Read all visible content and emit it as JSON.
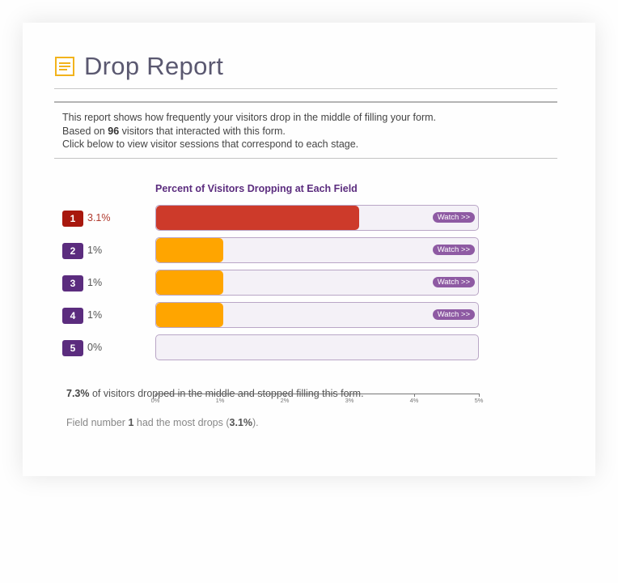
{
  "header": {
    "title": "Drop Report",
    "icon": "report-lines-icon"
  },
  "description": {
    "line1": "This report shows how frequently your visitors drop in the middle of filling your form.",
    "line2_prefix": "Based on ",
    "line2_count": "96",
    "line2_suffix": " visitors that interacted with this form.",
    "line3": "Click below to view visitor sessions that correspond to each stage."
  },
  "colors": {
    "top_field": "#cd3a2a",
    "top_badge": "#a8180e",
    "other_fields": "#ffa500",
    "badge": "#5b2c7e",
    "watch": "#8e5aa3"
  },
  "chart_data": {
    "type": "bar",
    "orientation": "horizontal",
    "title": "Percent of Visitors Dropping at Each Field",
    "xlabel": "",
    "ylabel": "",
    "xlim": [
      0,
      5
    ],
    "x_ticks": [
      "0%",
      "1%",
      "2%",
      "3%",
      "4%",
      "5%"
    ],
    "categories": [
      "1",
      "2",
      "3",
      "4",
      "5"
    ],
    "values": [
      3.1,
      1,
      1,
      1,
      0
    ],
    "value_labels": [
      "3.1%",
      "1%",
      "1%",
      "1%",
      "0%"
    ],
    "watch_buttons": [
      true,
      true,
      true,
      true,
      false
    ],
    "watch_label": "Watch  >>",
    "grid": false,
    "legend": "none"
  },
  "summary": {
    "total_pct": "7.3%",
    "total_text": " of visitors dropped in the middle and stopped filling this form.",
    "top_prefix": "Field number ",
    "top_field": "1",
    "top_middle": " had the most drops (",
    "top_pct": "3.1%",
    "top_suffix": ")."
  }
}
